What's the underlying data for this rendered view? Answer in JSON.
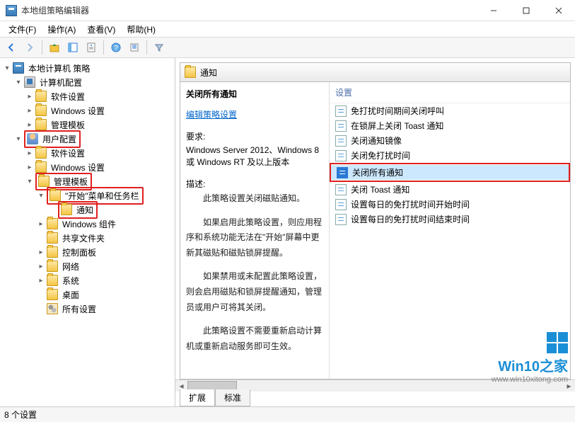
{
  "window": {
    "title": "本地组策略编辑器"
  },
  "menus": {
    "file": "文件(F)",
    "action": "操作(A)",
    "view": "查看(V)",
    "help": "帮助(H)"
  },
  "tree": {
    "root": "本地计算机 策略",
    "computer_cfg": "计算机配置",
    "cc_children": [
      "软件设置",
      "Windows 设置",
      "管理模板"
    ],
    "user_cfg": "用户配置",
    "uc_soft": "软件设置",
    "uc_win": "Windows 设置",
    "uc_tmpl": "管理模板",
    "start_taskbar": "\"开始\"菜单和任务栏",
    "notify": "通知",
    "win_comp": "Windows 组件",
    "shared": "共享文件夹",
    "ctrlpanel": "控制面板",
    "network": "网络",
    "system": "系统",
    "desktop": "桌面",
    "allsettings": "所有设置"
  },
  "header": {
    "folder": "通知"
  },
  "detail": {
    "title": "关闭所有通知",
    "edit_link": "编辑策略设置",
    "req_label": "要求:",
    "req_text": "Windows Server 2012、Windows 8 或 Windows RT 及以上版本",
    "desc_label": "描述:",
    "desc_p1": "此策略设置关闭磁贴通知。",
    "desc_p2": "如果启用此策略设置，则应用程序和系统功能无法在\"开始\"屏幕中更新其磁贴和磁贴锁屏提醒。",
    "desc_p3": "如果禁用或未配置此策略设置，则会启用磁贴和锁屏提醒通知，管理员或用户可将其关闭。",
    "desc_p4": "此策略设置不需要重新启动计算机或重新启动服务即可生效。"
  },
  "settings": {
    "column": "设置",
    "items": [
      "免打扰时间期间关闭呼叫",
      "在锁屏上关闭 Toast 通知",
      "关闭通知镜像",
      "关闭免打扰时间",
      "关闭所有通知",
      "关闭 Toast 通知",
      "设置每日的免打扰时间开始时间",
      "设置每日的免打扰时间结束时间"
    ],
    "selected_index": 4
  },
  "tabs": {
    "ext": "扩展",
    "std": "标准"
  },
  "status": {
    "text": "8 个设置"
  },
  "watermark": {
    "brand": "Win10之家",
    "url": "www.win10xitong.com"
  }
}
